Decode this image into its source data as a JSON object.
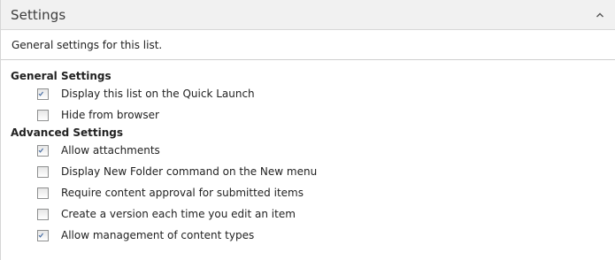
{
  "section": {
    "title": "Settings",
    "collapse_icon": "chevron-up-icon",
    "description": "General settings for this list."
  },
  "groups": [
    {
      "heading": "General Settings",
      "options": [
        {
          "label": "Display this list on the Quick Launch",
          "checked": true
        },
        {
          "label": "Hide from browser",
          "checked": false
        }
      ]
    },
    {
      "heading": "Advanced Settings",
      "options": [
        {
          "label": "Allow attachments",
          "checked": true
        },
        {
          "label": "Display New Folder command on the New menu",
          "checked": false
        },
        {
          "label": "Require content approval for submitted items",
          "checked": false
        },
        {
          "label": "Create a version each time you edit an item",
          "checked": false
        },
        {
          "label": "Allow management of content types",
          "checked": true
        }
      ]
    }
  ],
  "colors": {
    "header_bg": "#f1f1f1",
    "check_color": "#4a6fa5",
    "border": "#d6d6d6"
  }
}
